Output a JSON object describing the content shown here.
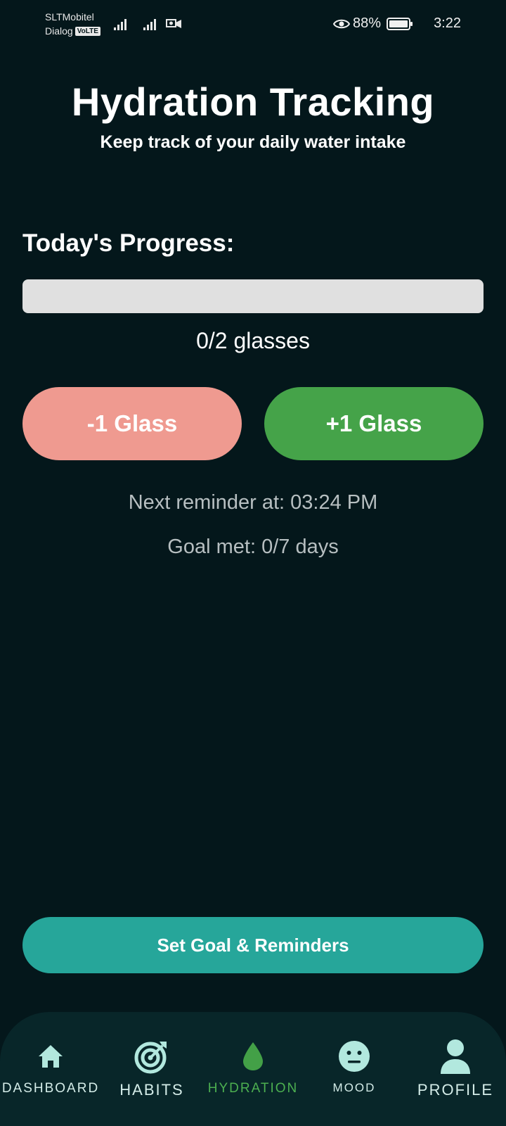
{
  "status_bar": {
    "carrier_1": "SLTMobitel",
    "carrier_2": "Dialog",
    "volte_badge": "VoLTE",
    "battery_percent": "88%",
    "time": "3:22",
    "icons": [
      "signal-icon",
      "signal-icon",
      "cast-icon",
      "eye-icon",
      "battery-icon"
    ]
  },
  "header": {
    "title": "Hydration Tracking",
    "subtitle": "Keep track of your daily water intake"
  },
  "progress": {
    "heading": "Today's Progress:",
    "fraction": 0,
    "text": "0/2 glasses"
  },
  "actions": {
    "minus_label": "-1 Glass",
    "plus_label": "+1 Glass"
  },
  "info": {
    "next_reminder": "Next reminder at: 03:24 PM",
    "goal_met": "Goal met: 0/7 days"
  },
  "set_goal_button": "Set Goal & Reminders",
  "bottom_nav": {
    "active": "hydration",
    "items": [
      {
        "id": "dashboard",
        "label": "DASHBOARD",
        "icon": "home-icon"
      },
      {
        "id": "habits",
        "label": "HABITS",
        "icon": "target-icon"
      },
      {
        "id": "hydration",
        "label": "HYDRATION",
        "icon": "water-drop-icon"
      },
      {
        "id": "mood",
        "label": "MOOD",
        "icon": "neutral-face-icon"
      },
      {
        "id": "profile",
        "label": "PROFILE",
        "icon": "person-icon"
      }
    ]
  },
  "colors": {
    "background": "#04171b",
    "progress_track": "#e0e0e0",
    "minus_button": "#ef9a90",
    "plus_button": "#45a349",
    "set_goal_button": "#26a69a",
    "nav_background": "#082629",
    "nav_active": "#4caf50",
    "nav_icon": "#b2e8de"
  }
}
